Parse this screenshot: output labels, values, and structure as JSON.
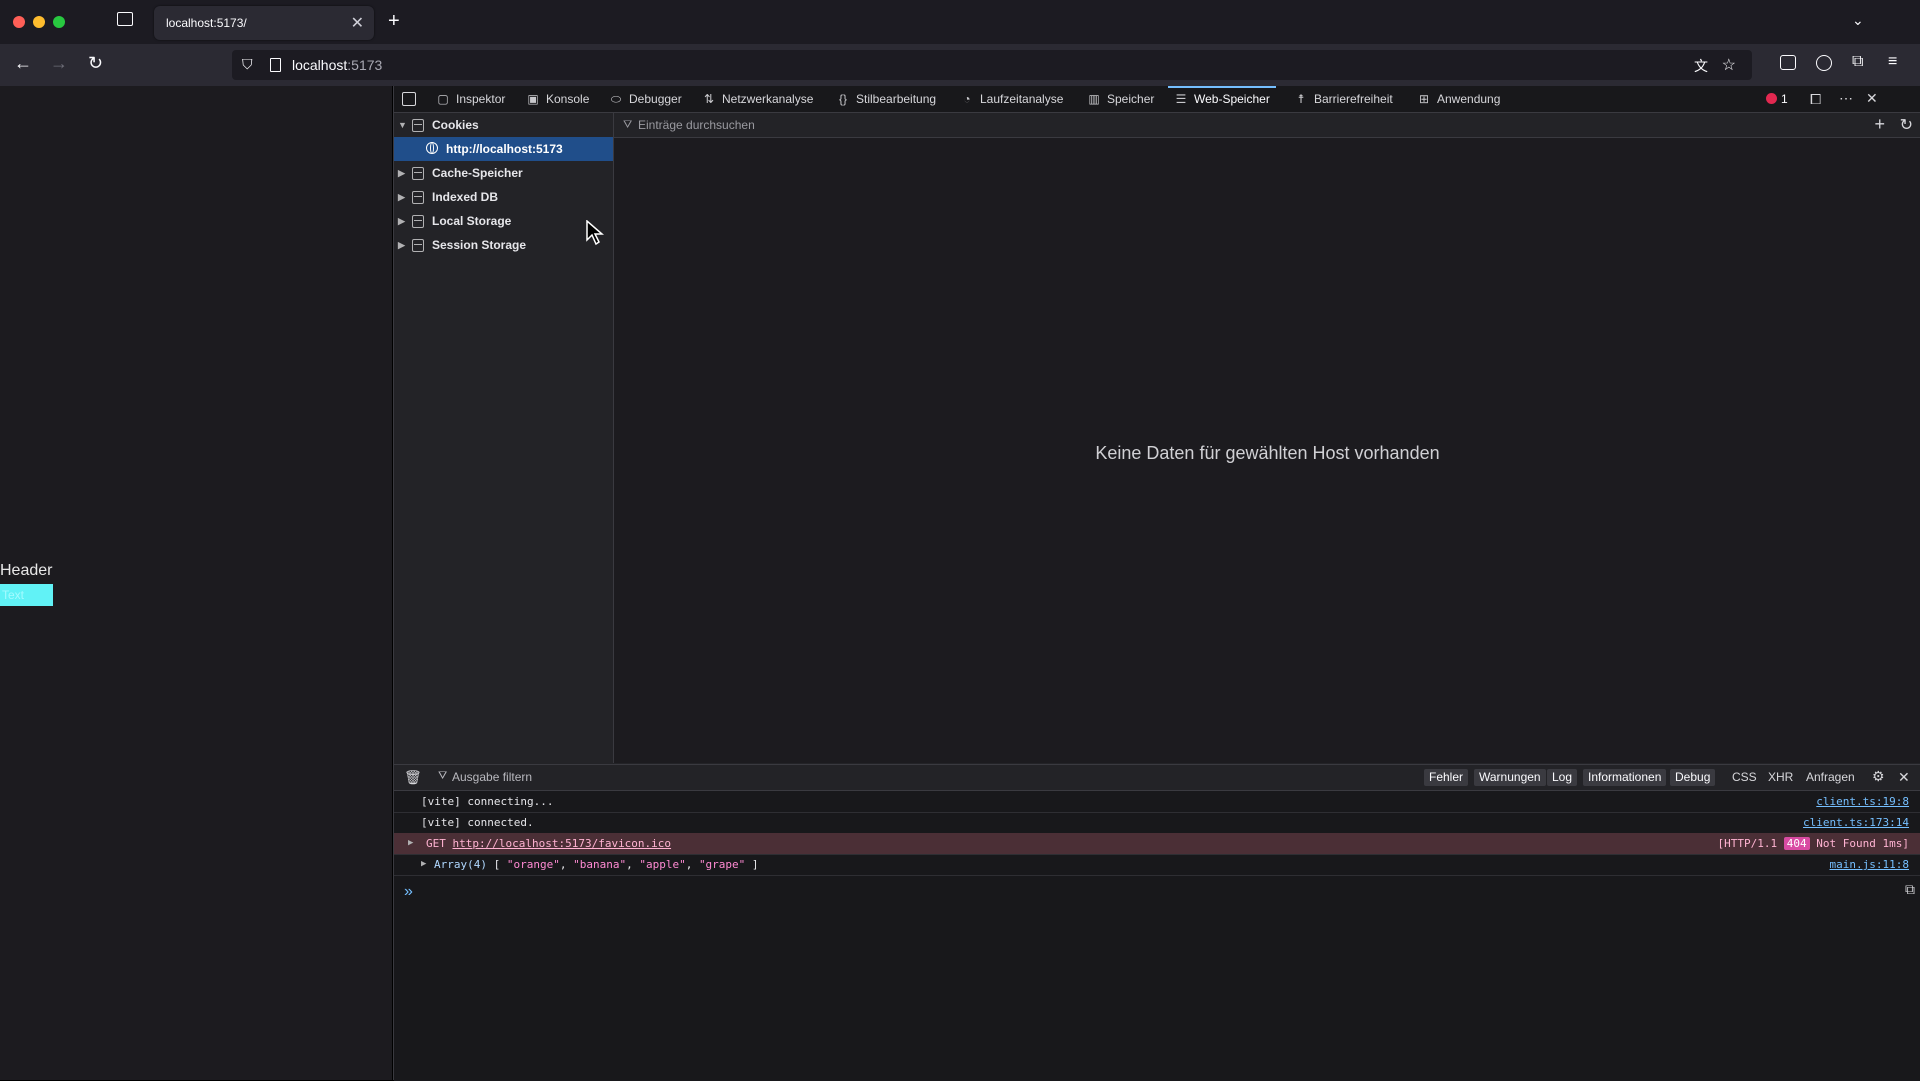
{
  "browser": {
    "tab_title": "localhost:5173/",
    "url_host": "localhost",
    "url_port": ":5173"
  },
  "page": {
    "header_text": "Header",
    "button_text": "Text"
  },
  "devtools": {
    "tabs": [
      {
        "label": "Inspektor",
        "icon": "inspector-icon"
      },
      {
        "label": "Konsole",
        "icon": "console-icon"
      },
      {
        "label": "Debugger",
        "icon": "debugger-icon"
      },
      {
        "label": "Netzwerkanalyse",
        "icon": "network-icon"
      },
      {
        "label": "Stilbearbeitung",
        "icon": "style-editor-icon"
      },
      {
        "label": "Laufzeitanalyse",
        "icon": "performance-icon"
      },
      {
        "label": "Speicher",
        "icon": "memory-icon"
      },
      {
        "label": "Web-Speicher",
        "icon": "storage-icon"
      },
      {
        "label": "Barrierefreiheit",
        "icon": "accessibility-icon"
      },
      {
        "label": "Anwendung",
        "icon": "application-icon"
      }
    ],
    "error_count": "1",
    "storage": {
      "tree": [
        "Cookies",
        "http://localhost:5173",
        "Cache-Speicher",
        "Indexed DB",
        "Local Storage",
        "Session Storage"
      ],
      "filter_placeholder": "Einträge durchsuchen",
      "empty_message": "Keine Daten für gewählten Host vorhanden"
    },
    "console": {
      "filter_placeholder": "Ausgabe filtern",
      "levels": [
        "Fehler",
        "Warnungen",
        "Log",
        "Informationen",
        "Debug"
      ],
      "extra": [
        "CSS",
        "XHR",
        "Anfragen"
      ],
      "logs": [
        {
          "msg": "[vite] connecting...",
          "src": "client.ts:19:8"
        },
        {
          "msg": "[vite] connected.",
          "src": "client.ts:173:14"
        },
        {
          "method": "GET",
          "url": "http://localhost:5173/favicon.ico",
          "proto": "[HTTP/1.1",
          "status": "404",
          "status_text": "Not Found 1ms]"
        },
        {
          "prefix": "Array(4)",
          "items": [
            "\"orange\"",
            "\"banana\"",
            "\"apple\"",
            "\"grape\""
          ],
          "src": "main.js:11:8"
        }
      ]
    }
  }
}
